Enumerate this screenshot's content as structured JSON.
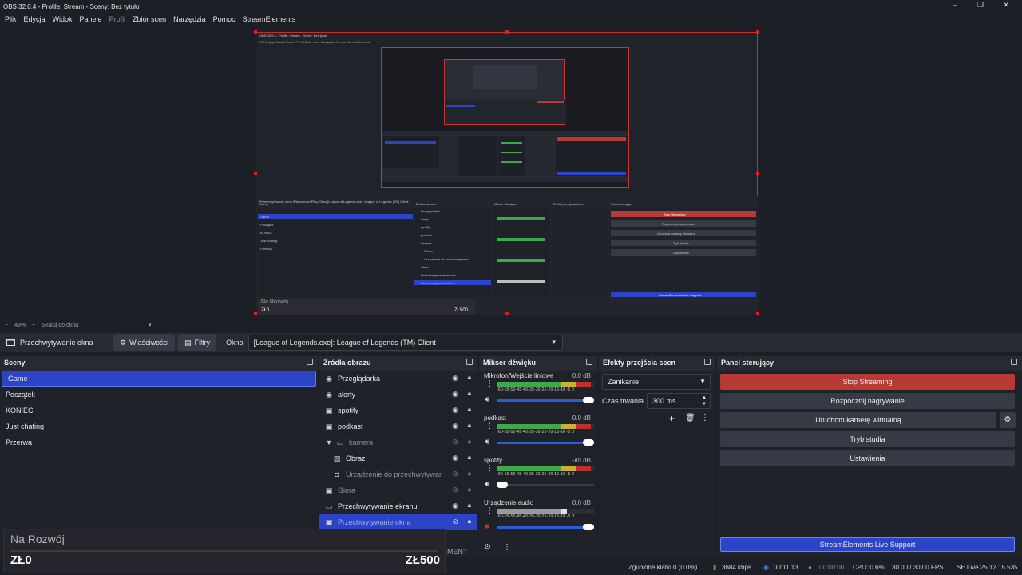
{
  "window": {
    "title": "OBS 32.0.4 - Profile: Stream - Sceny: Bez tytułu",
    "controls": [
      "–",
      "❐",
      "✕"
    ]
  },
  "menu": [
    "Plik",
    "Edycja",
    "Widok",
    "Panele",
    "Profil",
    "Zbiór scen",
    "Narzędzia",
    "Pomoc",
    "StreamElements"
  ],
  "nested_preview": {
    "title": "OBS 32.0.4 - Profile: Stream - Sceny: Bez tytułu",
    "menu": "Plik  Edycja  Widok  Panele  Profil  Zbiór scen  Narzędzia  Pomoc  StreamElements",
    "toolbar": "Przechwytywanie okna   Właściwości   Filtry   Okno  [League of Legends.exe]: League of Legends (TM) Client",
    "docks": [
      "Sceny",
      "Źródła obrazu",
      "Mikser dźwięku",
      "Efekty przejścia scen",
      "Panel sterujący"
    ],
    "scenes": [
      "Game",
      "Początek",
      "KONIEC",
      "Just chating",
      "Przerwa"
    ],
    "sources": [
      "Przeglądarka",
      "alerty",
      "spotify",
      "podkast",
      "kamera",
      "Obraz",
      "Urządzenie do przechwytywania",
      "Giera",
      "Przechwytywanie ekranu",
      "Przechwytywanie okna"
    ],
    "controls": [
      "Stop Streaming",
      "Rozpocznij nagrywanie",
      "Uruchom kamerę wirtualną",
      "Tryb studia",
      "Ustawienia"
    ],
    "support": "StreamElements Live Support",
    "overlay_title": "Na Rozwój",
    "overlay_left": "ZŁ0",
    "overlay_right": "ZŁ500"
  },
  "zoom": {
    "minus": "−",
    "value": "49%",
    "plus": "+",
    "mode": "Skaluj do okna",
    "arrow": "▾"
  },
  "source_toolbar": {
    "source_name": "Przechwytywanie okna",
    "properties_label": "Właściwości",
    "filters_label": "Filtry",
    "window_label": "Okno",
    "window_value": "[League of Legends.exe]: League of Legends (TM) Client"
  },
  "scenes": {
    "title": "Sceny",
    "items": [
      "Game",
      "Początek",
      "KONIEC",
      "Just chating",
      "Przerwa"
    ],
    "active_index": 0
  },
  "sources": {
    "title": "Źródła obrazu",
    "items": [
      {
        "label": "Przeglądarka",
        "icon": "globe-icon"
      },
      {
        "label": "alerty",
        "icon": "globe-icon"
      },
      {
        "label": "spotify",
        "icon": "window-icon"
      },
      {
        "label": "podkast",
        "icon": "window-icon"
      },
      {
        "label": "kamera",
        "icon": "folder-icon"
      },
      {
        "label": "Obraz",
        "icon": "image-icon"
      },
      {
        "label": "Urządzenie do przechwytywania",
        "icon": "camera-icon"
      },
      {
        "label": "Giera",
        "icon": "window-icon"
      },
      {
        "label": "Przechwytywanie ekranu",
        "icon": "monitor-icon"
      },
      {
        "label": "Przechwytywanie okna",
        "icon": "window-icon"
      }
    ],
    "footer_text": "MENT"
  },
  "mixer": {
    "title": "Mikser dźwięku",
    "channels": [
      {
        "name": "Mikrofon/Wejście liniowe",
        "db": "0.0 dB",
        "level": 0.96,
        "volume": 1.0
      },
      {
        "name": "podkast",
        "db": "0.0 dB",
        "level": 0.96,
        "volume": 1.0
      },
      {
        "name": "spotify",
        "db": "-inf dB",
        "level": 0.96,
        "volume": 0.0
      },
      {
        "name": "Urządzenie audio",
        "db": "0.0 dB",
        "level": 0.72,
        "volume": 1.0
      }
    ],
    "scale": "-60-55-50-45-40-35-30-25-20-15-10 -5  0",
    "footer_icons": [
      "gear-icon",
      "kebab-icon"
    ]
  },
  "transitions": {
    "title": "Efekty przejścia scen",
    "transition": "Zanikanie",
    "duration_label": "Czas trwania",
    "duration_value": "300 ms"
  },
  "controls": {
    "title": "Panel sterujący",
    "stop_streaming": "Stop Streaming",
    "start_recording": "Rozpocznij nagrywanie",
    "virtual_camera": "Uruchom kamerę wirtualną",
    "studio_mode": "Tryb studia",
    "settings": "Ustawienia",
    "support": "StreamElements Live Support"
  },
  "status": {
    "dropped_frames": "Zgubione klatki 0 (0.0%)",
    "bitrate": "3684 kbps",
    "stream_time": "00:11:13",
    "rec_time": "00:00:00",
    "cpu": "CPU: 0.6%",
    "fps": "30.00 / 30.00 FPS",
    "version": "SE.Live 25.12.15.535"
  },
  "overlay": {
    "title": "Na Rozwój",
    "left_amount": "ZŁ0",
    "right_amount": "ZŁ500"
  },
  "colors": {
    "accent_blue": "#2c45c8",
    "stop_red": "#b83a35",
    "selection_red": "#e01e1e",
    "meter_green": "#3ea84a",
    "meter_yellow": "#c9b133",
    "meter_red": "#c03030"
  }
}
